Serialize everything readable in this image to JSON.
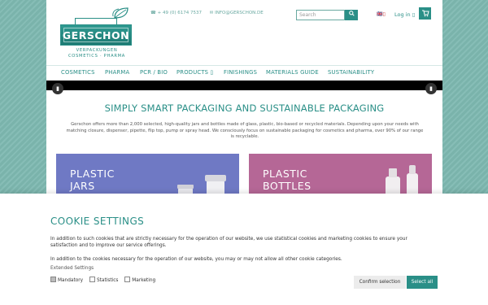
{
  "header": {
    "logo_text": "GERSCHON",
    "logo_sub1": "VERPACKUNGEN",
    "logo_sub2": "COSMETICS · PHARMA",
    "phone": "☎ + 49 (0) 6174 7537",
    "email": "✉ INFO@GERSCHON.DE",
    "search_placeholder": "Search",
    "login_label": "Log in",
    "lang_flag": "🇬🇧"
  },
  "nav": {
    "items": [
      "COSMETICS",
      "PHARMA",
      "PCR / BIO",
      "PRODUCTS ▯",
      "FINISHINGS",
      "MATERIALS GUIDE",
      "SUSTAINABILITY"
    ]
  },
  "main": {
    "headline": "SIMPLY SMART PACKAGING AND SUSTAINABLE PACKAGING",
    "intro": "Gerschon offers more than 2,000 selected, high-quality jars and bottles made of glass, plastic, bio-based or recycled materials. Depending upon your needs with matching closure, dispenser, pipette, flip top, pump or spray head. We consciously focus on sustainable packaging for cosmetics and pharma, over 90% of our range is recyclable.",
    "tiles": [
      {
        "label_line1": "PLASTIC",
        "label_line2": "JARS",
        "color": "#6f79c4"
      },
      {
        "label_line1": "PLASTIC",
        "label_line2": "BOTTLES",
        "color": "#b56796"
      }
    ]
  },
  "cookie": {
    "title": "COOKIE SETTINGS",
    "paragraph1": "In addition to such cookies that are strictly necessary for the operation of our website, we use statistical cookies and marketing cookies to ensure your satisfaction and to improve our service offerings.",
    "paragraph2": "In addition to the cookies necessary for the operation of our website, you may or may not allow all other cookie categories.",
    "extended_label": "Extended Settings",
    "checkbox_mandatory": "Mandatory",
    "checkbox_statistics": "Statistics",
    "checkbox_marketing": "Marketing",
    "confirm_label": "Confirm selection",
    "select_all_label": "Select all"
  },
  "colors": {
    "accent": "#2a8f87",
    "jar_tile": "#6f79c4",
    "bottle_tile": "#b56796"
  }
}
